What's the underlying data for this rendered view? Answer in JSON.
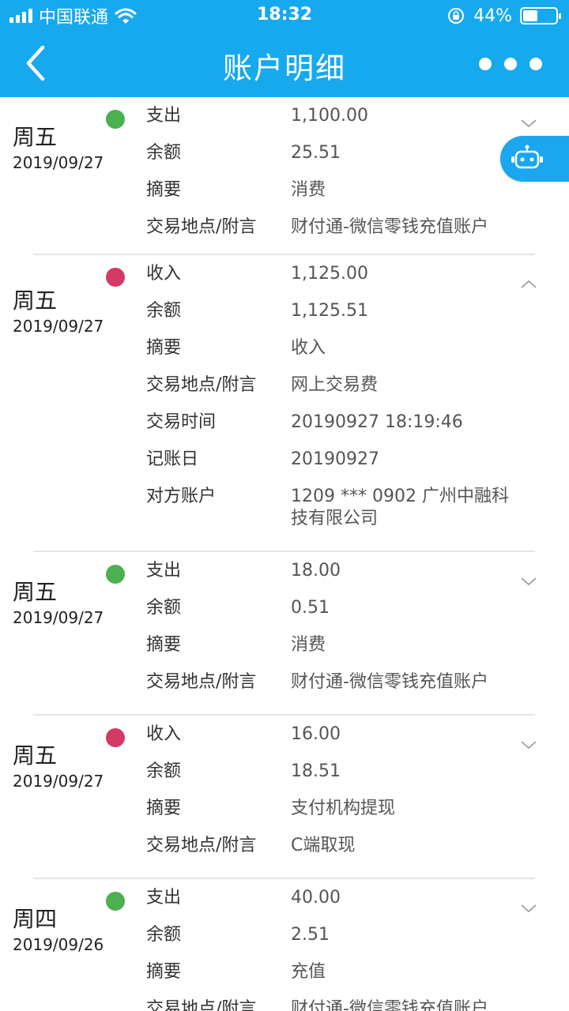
{
  "status_bar": {
    "carrier": "中国联通",
    "time": "18:32",
    "battery_percent": "44%",
    "battery_level": 0.44
  },
  "nav": {
    "title": "账户明细"
  },
  "colors": {
    "header": "#17a9ee",
    "expense": "#4caf50",
    "income": "#d33a66"
  },
  "records": [
    {
      "weekday": "周五",
      "date": "2019/09/27",
      "kind": "expense",
      "expanded": false,
      "rows": [
        {
          "label": "支出",
          "value": "1,100.00"
        },
        {
          "label": "余额",
          "value": "25.51"
        },
        {
          "label": "摘要",
          "value": "消费"
        },
        {
          "label": "交易地点/附言",
          "value": "财付通-微信零钱充值账户"
        }
      ]
    },
    {
      "weekday": "周五",
      "date": "2019/09/27",
      "kind": "income",
      "expanded": true,
      "rows": [
        {
          "label": "收入",
          "value": "1,125.00"
        },
        {
          "label": "余额",
          "value": "1,125.51"
        },
        {
          "label": "摘要",
          "value": "收入"
        },
        {
          "label": "交易地点/附言",
          "value": "网上交易费"
        },
        {
          "label": "交易时间",
          "value": "20190927 18:19:46"
        },
        {
          "label": "记账日",
          "value": "20190927"
        },
        {
          "label": "对方账户",
          "value": "1209 *** 0902 广州中融科技有限公司"
        }
      ]
    },
    {
      "weekday": "周五",
      "date": "2019/09/27",
      "kind": "expense",
      "expanded": false,
      "rows": [
        {
          "label": "支出",
          "value": "18.00"
        },
        {
          "label": "余额",
          "value": "0.51"
        },
        {
          "label": "摘要",
          "value": "消费"
        },
        {
          "label": "交易地点/附言",
          "value": "财付通-微信零钱充值账户"
        }
      ]
    },
    {
      "weekday": "周五",
      "date": "2019/09/27",
      "kind": "income",
      "expanded": false,
      "rows": [
        {
          "label": "收入",
          "value": "16.00"
        },
        {
          "label": "余额",
          "value": "18.51"
        },
        {
          "label": "摘要",
          "value": "支付机构提现"
        },
        {
          "label": "交易地点/附言",
          "value": "C端取现"
        }
      ]
    },
    {
      "weekday": "周四",
      "date": "2019/09/26",
      "kind": "expense",
      "expanded": false,
      "rows": [
        {
          "label": "支出",
          "value": "40.00"
        },
        {
          "label": "余额",
          "value": "2.51"
        },
        {
          "label": "摘要",
          "value": "充值"
        },
        {
          "label": "交易地点/附言",
          "value": "财付通-微信零钱充值账户"
        }
      ]
    }
  ]
}
